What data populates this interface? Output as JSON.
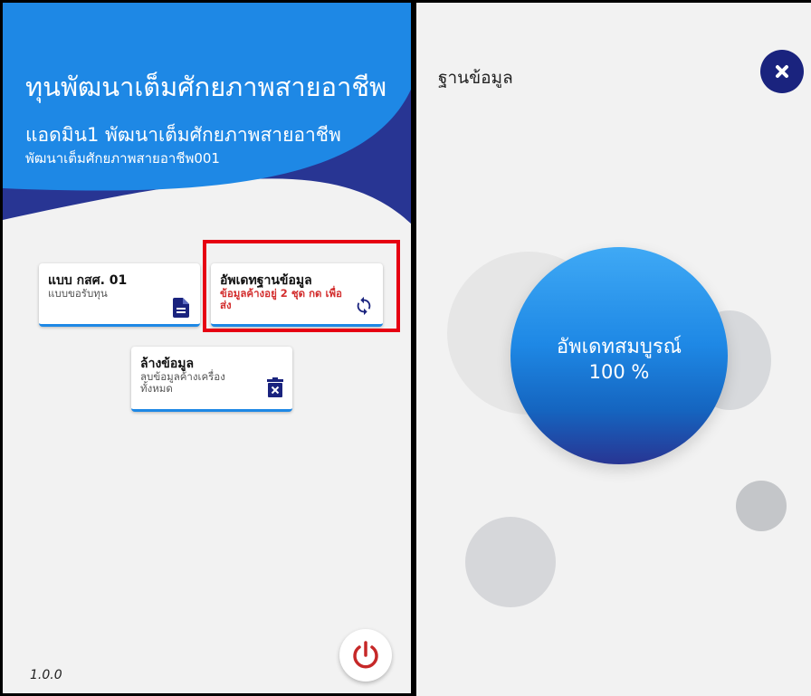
{
  "left_screen": {
    "header": {
      "title": "ทุนพัฒนาเต็มศักยภาพสายอาชีพ",
      "user_name": "แอดมิน1 พัฒนาเต็มศักยภาพสายอาชีพ",
      "user_id": "พัฒนาเต็มศักยภาพสายอาชีพ001",
      "colors": {
        "primary": "#1e88e5",
        "secondary": "#283593"
      }
    },
    "cards": {
      "form": {
        "title": "แบบ กสศ. 01",
        "desc": "แบบขอรับทุน",
        "icon": "document-icon"
      },
      "update": {
        "title": "อัพเดทฐานข้อมูล",
        "alert": "ข้อมูลค้างอยู่ 2 ชุด กด เพื่อส่ง",
        "icon": "sync-icon",
        "alert_color": "#d32f2f"
      },
      "clear": {
        "title": "ล้างข้อมูล",
        "desc": "ลบข้อมูลค้างเครื่อง ทั้งหมด",
        "icon": "delete-icon"
      }
    },
    "version": "1.0.0",
    "power_icon": "power-icon",
    "power_color": "#c62828"
  },
  "right_screen": {
    "title": "ฐานข้อมูล",
    "close_icon": "close-icon",
    "status_label": "อัพเดทสมบูรณ์",
    "progress_text": "100 %",
    "progress": 100
  }
}
